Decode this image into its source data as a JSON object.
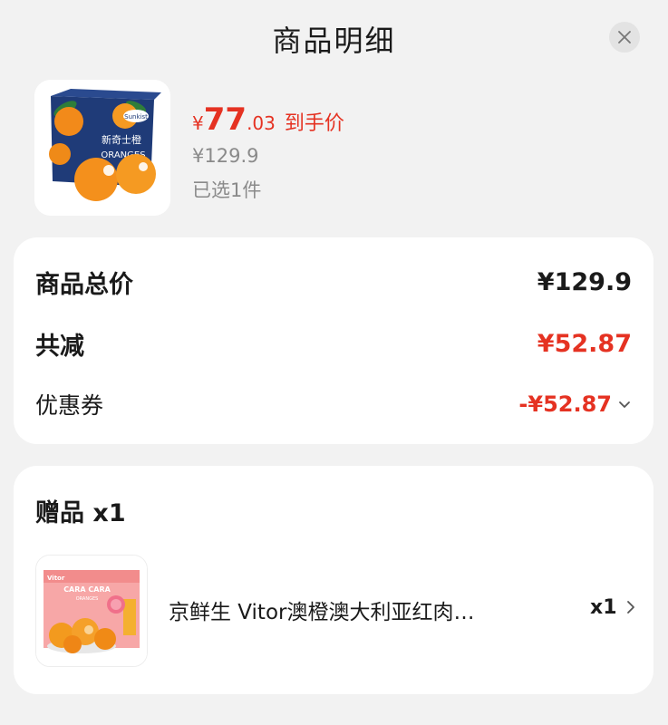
{
  "header": {
    "title": "商品明细"
  },
  "product": {
    "image": "orange-box-image",
    "price_currency": "¥",
    "price_int": "77",
    "price_dec": ".03",
    "price_tag": "到手价",
    "original_price": "¥129.9",
    "selected_text": "已选1件",
    "box_label": "新奇士橙",
    "box_label_en": "ORANGES",
    "brand_badge": "Sunkist"
  },
  "summary": {
    "total_label": "商品总价",
    "total_value": "¥129.9",
    "discount_label": "共减",
    "discount_value": "¥52.87",
    "coupon_label": "优惠券",
    "coupon_value": "-¥52.87"
  },
  "gift": {
    "title": "赠品 x1",
    "item_name": "京鲜生 Vitor澳橙澳大利亚红肉…",
    "item_qty": "x1",
    "box_text_1": "CARA CARA",
    "box_text_2": "ORANGES",
    "brand_badge": "Vitor"
  },
  "colors": {
    "accent_red": "#e53222",
    "muted_gray": "#8a8a8a",
    "background": "#f2f2f2",
    "card": "#ffffff"
  },
  "icons": {
    "close": "close-icon",
    "coupon_expand": "chevron-down-icon",
    "gift_more": "chevron-right-icon"
  }
}
